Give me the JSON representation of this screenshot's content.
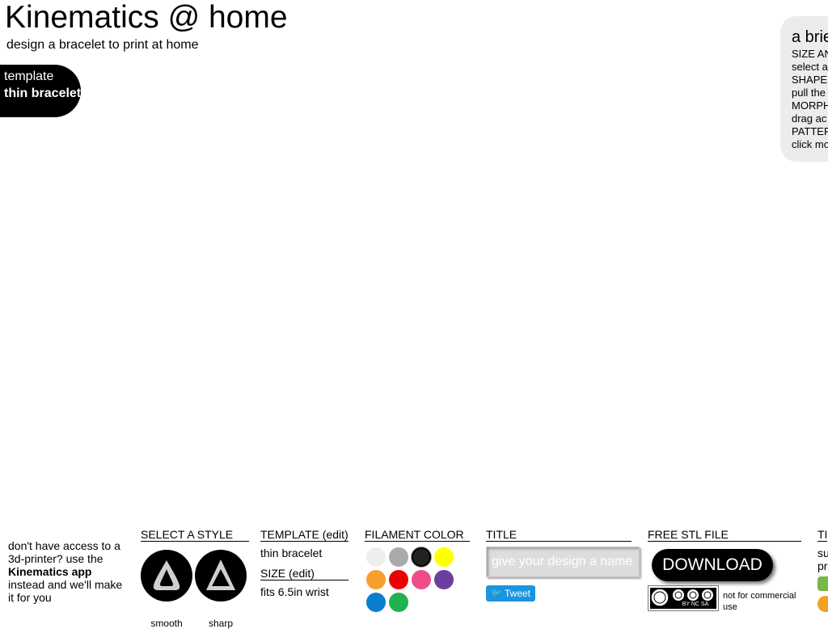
{
  "header": {
    "title": "Kinematics @ home",
    "subtitle": "design a bracelet to print at home"
  },
  "template_pill": {
    "label": "template",
    "value": "thin bracelet"
  },
  "help_panel": {
    "title": "a brie",
    "lines": [
      "SIZE AN",
      "select a",
      "SHAPE",
      "pull the",
      "MORPH",
      "drag ac",
      "PATTER",
      "click mo"
    ]
  },
  "printing": {
    "line1": "don't have access to a 3d-printer? use the",
    "app_name": "Kinematics app",
    "line2": "instead and we'll make it for you"
  },
  "style": {
    "heading": "SELECT A STYLE",
    "options": [
      {
        "label": "smooth",
        "icon": "smooth-style-icon"
      },
      {
        "label": "sharp",
        "icon": "sharp-style-icon"
      }
    ]
  },
  "template": {
    "heading": "TEMPLATE (edit)",
    "value": "thin bracelet",
    "size_heading": "SIZE (edit)",
    "size_value": "fits 6.5in wrist"
  },
  "filament": {
    "heading": "FILAMENT COLOR",
    "colors": [
      "#eeeeee",
      "#aaaaaa",
      "#222222",
      "#ffff00",
      "#f7a030",
      "#ee0000",
      "#ee4c8a",
      "#6a3fa0",
      "#0a7fd0",
      "#1fb34f"
    ],
    "selected": "#222222"
  },
  "title_section": {
    "heading": "TITLE",
    "placeholder": "give your design a name",
    "tweet_label": "Tweet"
  },
  "stl": {
    "heading": "FREE STL FILE",
    "download_label": "DOWNLOAD",
    "license_text": "BY  NC  SA",
    "license_note": "not for commercial use"
  },
  "tips": {
    "heading": "TI",
    "lines": [
      "su",
      "pr"
    ]
  }
}
